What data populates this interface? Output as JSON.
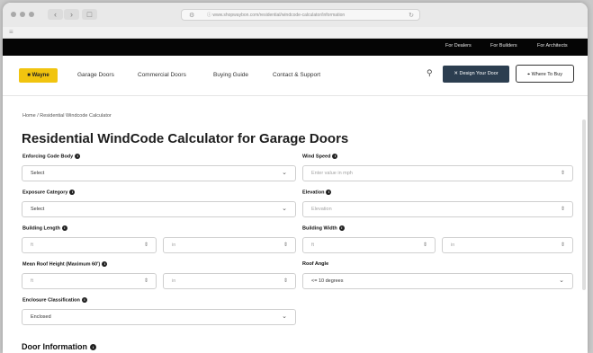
{
  "browser": {
    "url": "ⓘ www.shopwaybon.com/residential/windcode-calculator/information",
    "tab_icon": "≡"
  },
  "utility_nav": [
    "For Dealers",
    "For Builders",
    "For Architects"
  ],
  "logo": "■ Wayne",
  "nav": {
    "links": [
      "Garage Doors",
      "Commercial Doors",
      "Buying Guide",
      "Contact & Support"
    ],
    "design_button": "✕ Design Your Door",
    "where_button": "⌖ Where To Buy"
  },
  "breadcrumb": "Home / Residential Windcode Calculator",
  "title": "Residential WindCode Calculator for Garage Doors",
  "form": {
    "code_body": {
      "label": "Enforcing Code Body",
      "value": "Select"
    },
    "wind_speed": {
      "label": "Wind Speed",
      "placeholder": "Enter value in mph"
    },
    "exposure": {
      "label": "Exposure Category",
      "value": "Select"
    },
    "elevation": {
      "label": "Elevation",
      "placeholder": "Elevation"
    },
    "building_length": {
      "label": "Building Length",
      "ft": "ft",
      "in": "in"
    },
    "building_width": {
      "label": "Building Width",
      "ft": "ft",
      "in": "in"
    },
    "roof_height": {
      "label": "Mean Roof Height (Maximum 60')",
      "ft": "ft",
      "in": "in"
    },
    "roof_angle": {
      "label": "Roof Angle",
      "value": "<= 10 degrees"
    },
    "enclosure": {
      "label": "Enclosure Classification",
      "value": "Enclosed"
    }
  },
  "section": "Door Information",
  "info_glyph": "i"
}
